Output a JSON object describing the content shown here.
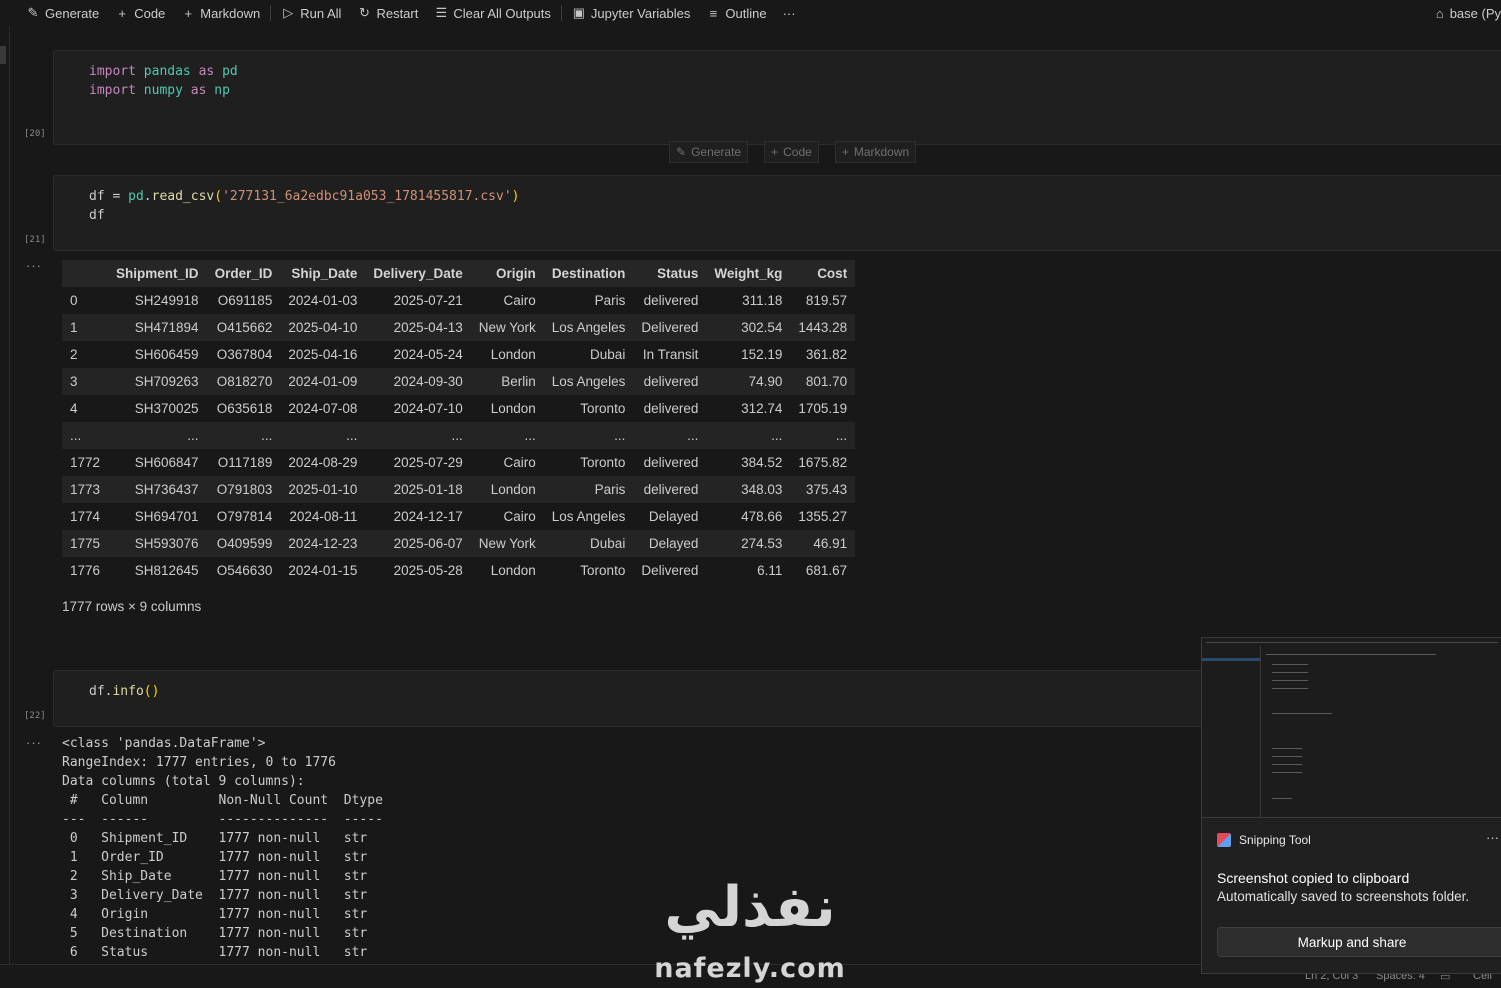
{
  "toolbar": {
    "generate": "Generate",
    "code": "Code",
    "markdown": "Markdown",
    "run_all": "Run All",
    "restart": "Restart",
    "clear_outputs": "Clear All Outputs",
    "jupyter_variables": "Jupyter Variables",
    "outline": "Outline",
    "more": "···",
    "kernel": "base (Py"
  },
  "add_bar": {
    "generate": "Generate",
    "code": "Code",
    "markdown": "Markdown"
  },
  "cells": [
    {
      "exec_count": "[20]",
      "lines": [
        {
          "kw1": "import",
          "mod": "pandas",
          "kw2": "as",
          "alias": "pd"
        },
        {
          "kw1": "import",
          "mod": "numpy",
          "kw2": "as",
          "alias": "np"
        }
      ]
    },
    {
      "exec_count": "[21]",
      "line1": {
        "var": "df",
        "op": " = ",
        "obj": "pd",
        "dot": ".",
        "fn": "read_csv",
        "open": "(",
        "arg": "'277131_6a2edbc91a053_1781455817.csv'",
        "close": ")"
      },
      "line2": "df"
    },
    {
      "exec_count": "[22]",
      "line1": {
        "var": "df",
        "dot": ".",
        "fn": "info",
        "open": "(",
        "close": ")"
      }
    }
  ],
  "output_dots": "···",
  "dataframe": {
    "columns": [
      "",
      "Shipment_ID",
      "Order_ID",
      "Ship_Date",
      "Delivery_Date",
      "Origin",
      "Destination",
      "Status",
      "Weight_kg",
      "Cost"
    ],
    "rows": [
      [
        "0",
        "SH249918",
        "O691185",
        "2024-01-03",
        "2025-07-21",
        "Cairo",
        "Paris",
        "delivered",
        "311.18",
        "819.57"
      ],
      [
        "1",
        "SH471894",
        "O415662",
        "2025-04-10",
        "2025-04-13",
        "New York",
        "Los Angeles",
        "Delivered",
        "302.54",
        "1443.28"
      ],
      [
        "2",
        "SH606459",
        "O367804",
        "2025-04-16",
        "2024-05-24",
        "London",
        "Dubai",
        "In Transit",
        "152.19",
        "361.82"
      ],
      [
        "3",
        "SH709263",
        "O818270",
        "2024-01-09",
        "2024-09-30",
        "Berlin",
        "Los Angeles",
        "delivered",
        "74.90",
        "801.70"
      ],
      [
        "4",
        "SH370025",
        "O635618",
        "2024-07-08",
        "2024-07-10",
        "London",
        "Toronto",
        "delivered",
        "312.74",
        "1705.19"
      ],
      [
        "...",
        "...",
        "...",
        "...",
        "...",
        "...",
        "...",
        "...",
        "...",
        "..."
      ],
      [
        "1772",
        "SH606847",
        "O117189",
        "2024-08-29",
        "2025-07-29",
        "Cairo",
        "Toronto",
        "delivered",
        "384.52",
        "1675.82"
      ],
      [
        "1773",
        "SH736437",
        "O791803",
        "2025-01-10",
        "2025-01-18",
        "London",
        "Paris",
        "delivered",
        "348.03",
        "375.43"
      ],
      [
        "1774",
        "SH694701",
        "O797814",
        "2024-08-11",
        "2024-12-17",
        "Cairo",
        "Los Angeles",
        "Delayed",
        "478.66",
        "1355.27"
      ],
      [
        "1775",
        "SH593076",
        "O409599",
        "2024-12-23",
        "2025-06-07",
        "New York",
        "Dubai",
        "Delayed",
        "274.53",
        "46.91"
      ],
      [
        "1776",
        "SH812645",
        "O546630",
        "2024-01-15",
        "2025-05-28",
        "London",
        "Toronto",
        "Delivered",
        "6.11",
        "681.67"
      ]
    ],
    "shape": "1777 rows × 9 columns"
  },
  "info_output": [
    "<class 'pandas.DataFrame'>",
    "RangeIndex: 1777 entries, 0 to 1776",
    "Data columns (total 9 columns):",
    " #   Column         Non-Null Count  Dtype",
    "---  ------         --------------  -----",
    " 0   Shipment_ID    1777 non-null   str",
    " 1   Order_ID       1777 non-null   str",
    " 2   Ship_Date      1777 non-null   str",
    " 3   Delivery_Date  1777 non-null   str",
    " 4   Origin         1777 non-null   str",
    " 5   Destination    1777 non-null   str",
    " 6   Status         1777 non-null   str"
  ],
  "statusbar": {
    "position": "Ln 2, Col 3",
    "spaces": "Spaces: 4",
    "cell": "Cell"
  },
  "watermark": {
    "arabic": "نفذلي",
    "latin": "nafezly.com"
  },
  "toast": {
    "app": "Snipping Tool",
    "more": "···",
    "title": "Screenshot copied to clipboard",
    "body": "Automatically saved to screenshots folder.",
    "button": "Markup and share"
  }
}
